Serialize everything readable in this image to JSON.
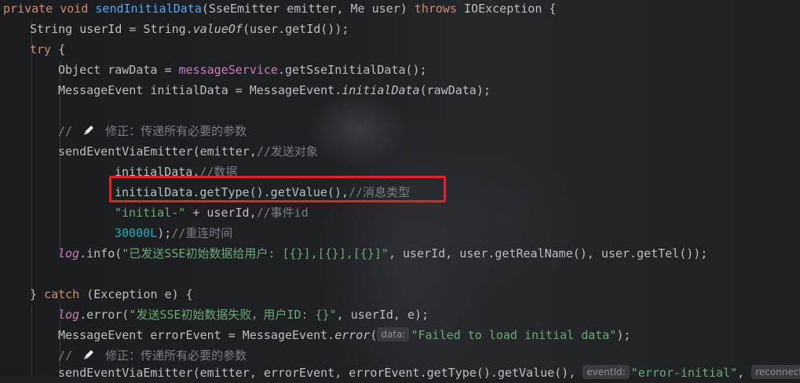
{
  "code": {
    "l1": {
      "kw1": "private void ",
      "fn": "sendInitialData",
      "rest1": "(SseEmitter emitter, Me user) ",
      "kw2": "throws",
      "rest2": " IOException {"
    },
    "l2": {
      "a": "String userId = String.",
      "m": "valueOf",
      "b": "(user.getId());"
    },
    "l3": {
      "kw": "try",
      "b": " {"
    },
    "l4": {
      "a": "Object rawData = ",
      "fld": "messageService",
      "b": ".getSseInitialData();"
    },
    "l5": {
      "a": "MessageEvent initialData = MessageEvent.",
      "m": "initialData",
      "b": "(rawData);"
    },
    "l7": {
      "c1": "// ",
      "c2": " 修正：传递所有必要的参数"
    },
    "l8": {
      "a": "sendEventViaEmitter(emitter,",
      "c": "//发送对象"
    },
    "l9": {
      "a": "initialData,",
      "c": "//数据"
    },
    "l10": {
      "a": "initialData.getType().getValue(),",
      "c": "//消息类型"
    },
    "l11": {
      "s": "\"initial-\"",
      "a": " + userId,",
      "c": "//事件id"
    },
    "l12": {
      "n": "30000L",
      "a": ");",
      "c": "//重连时间"
    },
    "l13": {
      "v": "log",
      "a": ".info(",
      "s": "\"已发送SSE初始数据给用户: [{}],[{}],[{}]\"",
      "b": ", userId, user.getRealName(), user.getTel());"
    },
    "l15": {
      "a": "} ",
      "kw": "catch",
      "b": " (Exception e) {"
    },
    "l16": {
      "v": "log",
      "a": ".error(",
      "s": "\"发送SSE初始数据失败，用户ID: {}\"",
      "b": ", userId, e);"
    },
    "l17": {
      "a": "MessageEvent errorEvent = MessageEvent.",
      "m": "error",
      "b": "(",
      "hint": "data:",
      "s": "\"Failed to load initial data\"",
      "c": ");"
    },
    "l18": {
      "c1": "// ",
      "c2": " 修正：传递所有必要的参数"
    },
    "l19": {
      "a": "sendEventViaEmitter(emitter, errorEvent, errorEvent.getType().getValue(), ",
      "hint1": "eventId:",
      "s": "\"error-initial\"",
      ",": ", ",
      "hint2": "reconnect"
    }
  },
  "icons": {
    "pencil": "pencil-icon"
  }
}
